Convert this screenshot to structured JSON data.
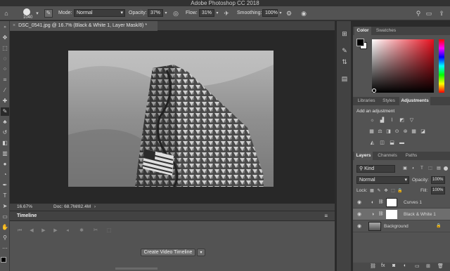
{
  "app": {
    "title": "Adobe Photoshop CC 2018"
  },
  "options": {
    "brush_size": "1040",
    "mode_label": "Mode:",
    "mode_value": "Normal",
    "opacity_label": "Opacity:",
    "opacity_value": "37%",
    "flow_label": "Flow:",
    "flow_value": "31%",
    "smoothing_label": "Smoothing:",
    "smoothing_value": "100%"
  },
  "document": {
    "tab_title": "DSC_0541.jpg @ 16.7% (Black & White 1, Layer Mask/8) *",
    "zoom": "16.67%",
    "doc_size": "Doc: 68.7M/82.4M"
  },
  "timeline": {
    "title": "Timeline",
    "create_button": "Create Video Timeline"
  },
  "color_panel": {
    "tabs": [
      "Color",
      "Swatches"
    ],
    "foreground": "#000000",
    "background": "#ffffff",
    "hue_color": "#e8101e"
  },
  "adjustments_panel": {
    "tabs": [
      "Libraries",
      "Styles",
      "Adjustments"
    ],
    "add_label": "Add an adjustment"
  },
  "layers_panel": {
    "tabs": [
      "Layers",
      "Channels",
      "Paths"
    ],
    "filter": "Kind",
    "blend_mode": "Normal",
    "opacity_label": "Opacity:",
    "opacity_value": "100%",
    "lock_label": "Lock:",
    "fill_label": "Fill:",
    "fill_value": "100%",
    "layers": [
      {
        "name": "Curves 1"
      },
      {
        "name": "Black & White 1"
      },
      {
        "name": "Background"
      }
    ]
  }
}
